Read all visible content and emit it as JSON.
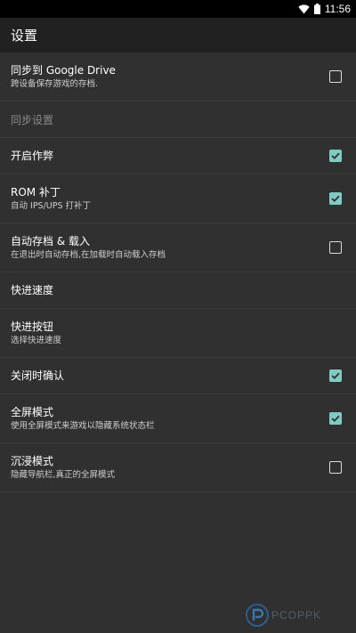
{
  "status_bar": {
    "time": "11:56",
    "icons": [
      "wifi-icon",
      "battery-icon"
    ]
  },
  "app_bar": {
    "title": "设置"
  },
  "settings": [
    {
      "title": "同步到 Google Drive",
      "summary": "跨设备保存游戏的存档.",
      "checked": false
    },
    {
      "category": "同步设置"
    },
    {
      "title": "开启作弊",
      "checked": true
    },
    {
      "title": "ROM 补丁",
      "summary": "自动 IPS/UPS 打补丁",
      "checked": true
    },
    {
      "title": "自动存档 & 载入",
      "summary": "在退出时自动存档,在加载时自动载入存档",
      "checked": false
    },
    {
      "title": "快进速度"
    },
    {
      "title": "快进按钮",
      "summary": "选择快进速度"
    },
    {
      "title": "关闭时确认",
      "checked": true
    },
    {
      "title": "全屏模式",
      "summary": "使用全屏模式来游戏以隐藏系统状态栏",
      "checked": true
    },
    {
      "title": "沉浸模式",
      "summary": "隐藏导航栏,真正的全屏模式",
      "checked": false
    }
  ],
  "watermark": {
    "text": "PCOPPK"
  },
  "colors": {
    "accent": "#80cbc4",
    "background": "#303030",
    "app_bar": "#212121"
  }
}
